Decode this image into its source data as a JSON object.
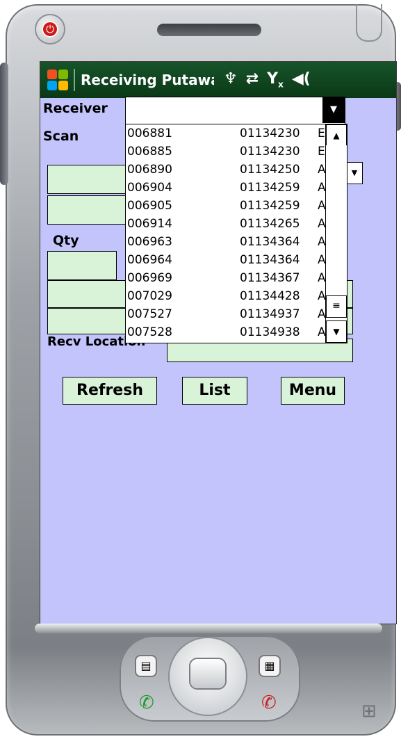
{
  "app": {
    "title": "Receiving Putawa"
  },
  "form": {
    "receiver_label": "Receiver",
    "scan_label": "Scan",
    "qty_label": "Qty",
    "recv_location_label": "Recv Location"
  },
  "dropdown_list": {
    "rows": [
      {
        "c1": "006881",
        "c2": "01134230",
        "c3": "E"
      },
      {
        "c1": "006885",
        "c2": "01134230",
        "c3": "E"
      },
      {
        "c1": "006890",
        "c2": "01134250",
        "c3": "A"
      },
      {
        "c1": "006904",
        "c2": "01134259",
        "c3": "A"
      },
      {
        "c1": "006905",
        "c2": "01134259",
        "c3": "A"
      },
      {
        "c1": "006914",
        "c2": "01134265",
        "c3": "A"
      },
      {
        "c1": "006963",
        "c2": "01134364",
        "c3": "A"
      },
      {
        "c1": "006964",
        "c2": "01134364",
        "c3": "A"
      },
      {
        "c1": "006969",
        "c2": "01134367",
        "c3": "A"
      },
      {
        "c1": "007029",
        "c2": "01134428",
        "c3": "A"
      },
      {
        "c1": "007527",
        "c2": "01134937",
        "c3": "A"
      },
      {
        "c1": "007528",
        "c2": "01134938",
        "c3": "A"
      }
    ]
  },
  "buttons": {
    "refresh": "Refresh",
    "list": "List",
    "menu": "Menu"
  },
  "icons": {
    "start": "windows-flag-icon",
    "signal": "antenna-icon",
    "sync": "sync-arrows-icon",
    "no_signal": "no-signal-icon",
    "volume": "speaker-icon"
  },
  "colors": {
    "titlebar": "#0a3816",
    "screen_bg": "#c4c4fc",
    "field_bg": "#d9f3d9",
    "power_button": "#cf1a1a"
  }
}
